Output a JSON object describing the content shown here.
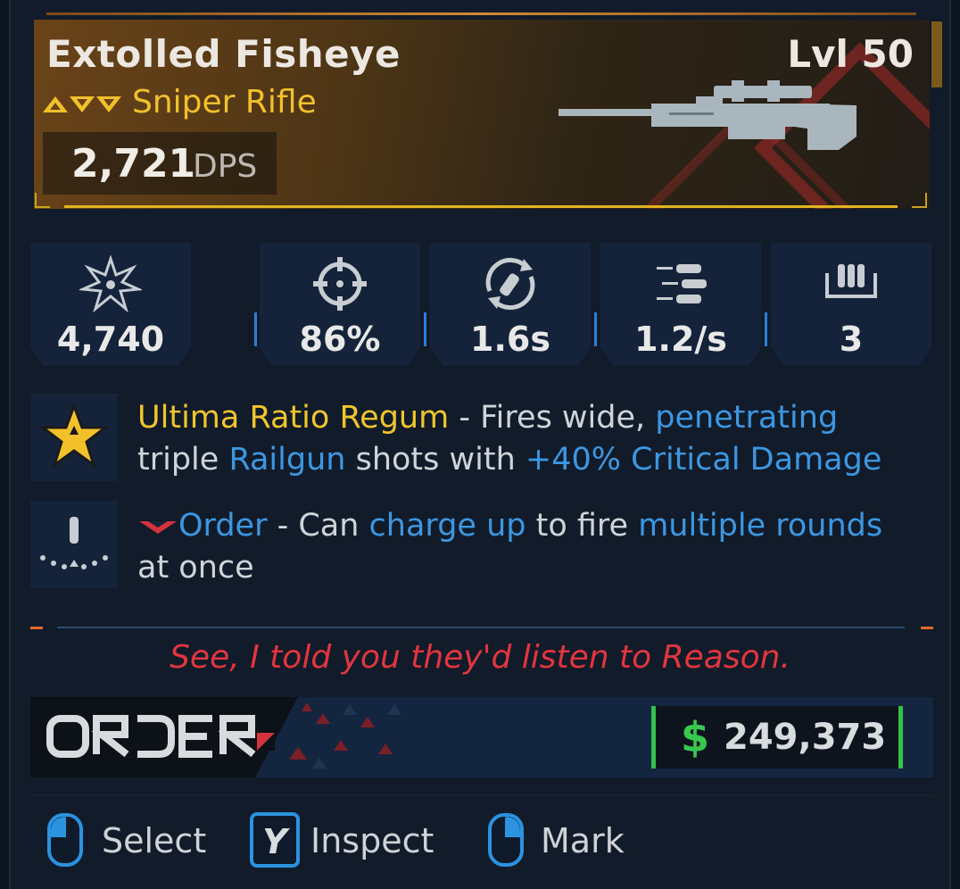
{
  "item": {
    "name": "Extolled Fisheye",
    "level": "Lvl 50",
    "type": "Sniper Rifle",
    "dps_value": "2,721",
    "dps_label": "DPS"
  },
  "stats": [
    {
      "icon": "damage-burst-icon",
      "value": "4,740"
    },
    {
      "icon": "crosshair-accuracy-icon",
      "value": "86%"
    },
    {
      "icon": "reload-icon",
      "value": "1.6s"
    },
    {
      "icon": "fire-rate-icon",
      "value": "1.2/s"
    },
    {
      "icon": "magazine-icon",
      "value": "3"
    }
  ],
  "perks": [
    {
      "icon": "gold-star-perk-icon",
      "name": "Ultima Ratio Regum",
      "sep1": " - Fires wide, ",
      "kw1": "penetrating",
      "line2a": "triple ",
      "kw2": "Railgun",
      "line2b": " shots with ",
      "kw3": "+40% Critical Damage"
    },
    {
      "icon": "order-round-perk-icon",
      "manufacturer": "Order",
      "sep1": " - Can ",
      "kw1": "charge up",
      "mid": " to fire ",
      "kw2": "multiple rounds",
      "line2": "at once"
    }
  ],
  "flavor_text": "See, I told you they'd listen to Reason.",
  "brand": {
    "name": "ORDER"
  },
  "price": {
    "symbol": "$",
    "value": "249,373"
  },
  "prompts": [
    {
      "icon": "mouse-left-icon",
      "label": "Select"
    },
    {
      "icon": "y-key-icon",
      "key": "Y",
      "label": "Inspect"
    },
    {
      "icon": "mouse-right-icon",
      "label": "Mark"
    }
  ],
  "colors": {
    "rarity_gold": "#f2c12a",
    "keyword_blue": "#3c97e2",
    "flavor_red": "#e2353f",
    "price_green": "#33c24a"
  }
}
